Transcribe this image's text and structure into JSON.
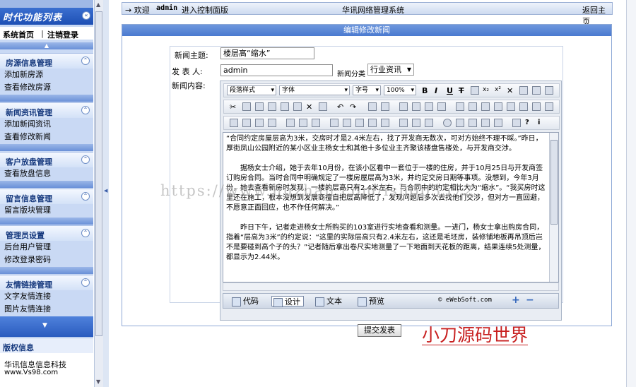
{
  "sidebar": {
    "title": "时代功能列表",
    "top_links": [
      "系统首页",
      "注销登录"
    ],
    "sections": [
      {
        "title": "房源信息管理",
        "items": [
          "添加新房源",
          "查看修改房源"
        ]
      },
      {
        "title": "新闻资讯管理",
        "items": [
          "添加新闻资讯",
          "查看修改新闻"
        ]
      },
      {
        "title": "客户放盘管理",
        "items": [
          "查看放盘信息"
        ]
      },
      {
        "title": "留言信息管理",
        "items": [
          "留言版块管理"
        ]
      },
      {
        "title": "管理员设置",
        "items": [
          "后台用户管理",
          "修改登录密码"
        ]
      },
      {
        "title": "友情链接管理",
        "items": [
          "文字友情连接",
          "图片友情连接"
        ]
      }
    ],
    "rights_title": "版权信息",
    "footer_company": "华讯信息信息科技",
    "footer_site": "www.Vs98.com"
  },
  "topbar": {
    "welcome": "→ 欢迎",
    "user": "admin",
    "enter": "进入控制面版",
    "system_name": "华讯网络管理系统",
    "back_home": "返回主页"
  },
  "form": {
    "panel_title": "编辑修改新闻",
    "title_label": "新闻主题:",
    "title_value": "楼层高“缩水”",
    "author_label": "发 表 人:",
    "author_value": "admin",
    "category_label": "新闻分类",
    "category_value": "行业资讯",
    "content_label": "新闻内容:",
    "submit_label": "提交发表"
  },
  "editor": {
    "style_dropdown": "段落样式",
    "font_dropdown": "字体",
    "size_dropdown": "字号",
    "zoom_dropdown": "100%",
    "paragraphs": [
      "“合同约定房屋层高为3米，交房时才是2.4米左右，找了开发商无数次，可对方始终不理不睬。”昨日，厚街凤山公园附近的某小区业主杨女士和其他十多位业主齐聚该楼盘售楼处，与开发商交涉。",
      "据杨女士介绍，她于去年10月份，在该小区看中一套位于一楼的住房，并于10月25日与开发商签订购房合同。当时合同中明确规定了一楼房屋层高为3米，并约定交房日期等事项。没想到，今年3月份，她去查看新房时发现，一楼的层高只有2.4米左右，与合同中的约定相比大为“缩水”。“我买房时这里还在施工，根本没想到发展商擅自把层高降低了，发现问题后多次去找他们交涉，但对方一直回避，不愿意正面回应，也不作任何解决。”",
      "昨日下午，记者走进杨女士所购买的103室进行实地查看和测量。一进门，杨女士拿出购房合同，指着“层高为3米”的约定说：“这里的实际层高只有2.4米左右，这还是毛坯房，装修铺地板再吊顶后岂不是要碰到高个子的头？”记者随后拿出卷尺实地测量了一下地面到天花板的距离，结果连续5处测量，都显示为2.44米。"
    ],
    "modes": [
      "代码",
      "设计",
      "文本",
      "预览"
    ],
    "brand": "© eWebSoft.com"
  },
  "watermarks": {
    "url": "https://www.huzhan.com/ishop3572",
    "brand_cn": "小刀源码世界"
  }
}
